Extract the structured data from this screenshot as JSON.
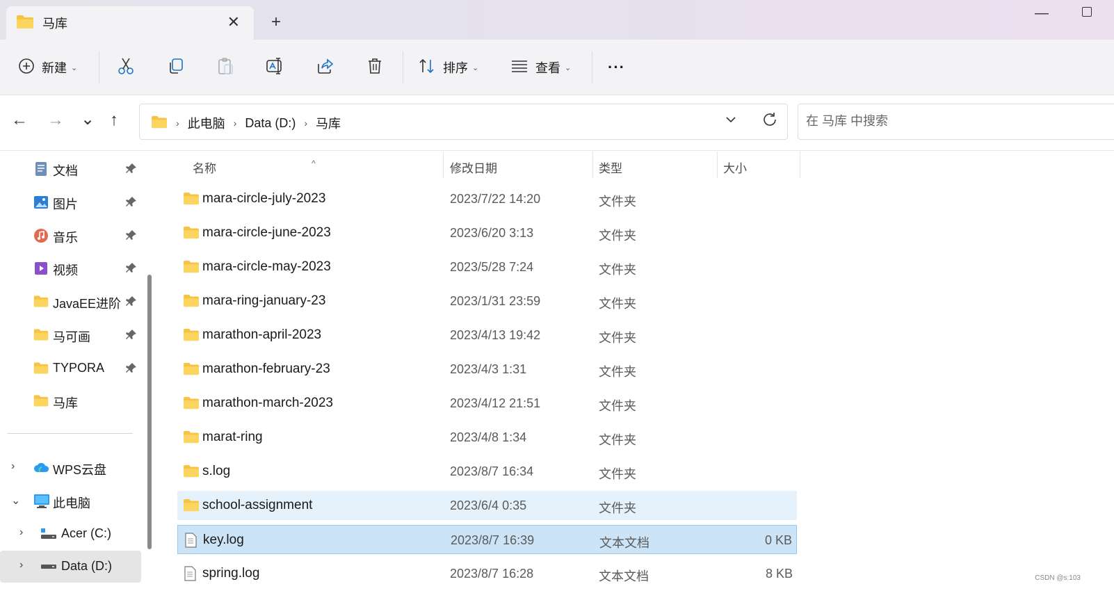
{
  "window": {
    "tab_title": "马库",
    "tab_close": "✕",
    "new_tab": "+",
    "minimize": "—"
  },
  "toolbar": {
    "new_label": "新建",
    "sort_label": "排序",
    "view_label": "查看",
    "more_label": "···"
  },
  "nav": {
    "back": "←",
    "forward": "→",
    "recent": "⌄",
    "up": "↑"
  },
  "address": {
    "crumbs": [
      "此电脑",
      "Data (D:)",
      "马库"
    ],
    "separator": "›"
  },
  "search": {
    "placeholder": "在 马库 中搜索"
  },
  "sidebar": {
    "quick_access": [
      {
        "label": "文档",
        "icon": "documents-icon",
        "pinned": true
      },
      {
        "label": "图片",
        "icon": "pictures-icon",
        "pinned": true
      },
      {
        "label": "音乐",
        "icon": "music-icon",
        "pinned": true
      },
      {
        "label": "视频",
        "icon": "videos-icon",
        "pinned": true
      },
      {
        "label": "JavaEE进阶",
        "icon": "folder-icon",
        "pinned": true
      },
      {
        "label": "马可画",
        "icon": "folder-icon",
        "pinned": true
      },
      {
        "label": "TYPORA",
        "icon": "folder-icon",
        "pinned": true
      },
      {
        "label": "马库",
        "icon": "folder-icon",
        "pinned": false
      }
    ],
    "tree": [
      {
        "label": "WPS云盘",
        "icon": "cloud-icon",
        "chevron": "›"
      },
      {
        "label": "此电脑",
        "icon": "pc-icon",
        "chevron": "⌄"
      },
      {
        "label": "Acer (C:)",
        "icon": "drive-c-icon",
        "chevron": "›"
      },
      {
        "label": "Data (D:)",
        "icon": "drive-icon",
        "chevron": "›"
      }
    ],
    "pin_glyph": "📌"
  },
  "columns": {
    "name": "名称",
    "date": "修改日期",
    "type": "类型",
    "size": "大小",
    "sort_arrow": "^"
  },
  "files": [
    {
      "name": "mara-circle-july-2023",
      "date": "2023/7/22 14:20",
      "type": "文件夹",
      "size": ""
    },
    {
      "name": "mara-circle-june-2023",
      "date": "2023/6/20 3:13",
      "type": "文件夹",
      "size": ""
    },
    {
      "name": "mara-circle-may-2023",
      "date": "2023/5/28 7:24",
      "type": "文件夹",
      "size": ""
    },
    {
      "name": "mara-ring-january-23",
      "date": "2023/1/31 23:59",
      "type": "文件夹",
      "size": ""
    },
    {
      "name": "marathon-april-2023",
      "date": "2023/4/13 19:42",
      "type": "文件夹",
      "size": ""
    },
    {
      "name": "marathon-february-23",
      "date": "2023/4/3 1:31",
      "type": "文件夹",
      "size": ""
    },
    {
      "name": "marathon-march-2023",
      "date": "2023/4/12 21:51",
      "type": "文件夹",
      "size": ""
    },
    {
      "name": "marat-ring",
      "date": "2023/4/8 1:34",
      "type": "文件夹",
      "size": ""
    },
    {
      "name": "s.log",
      "date": "2023/8/7 16:34",
      "type": "文件夹",
      "size": ""
    },
    {
      "name": "school-assignment",
      "date": "2023/6/4 0:35",
      "type": "文件夹",
      "size": ""
    },
    {
      "name": "key.log",
      "date": "2023/8/7 16:39",
      "type": "文本文档",
      "size": "0 KB"
    },
    {
      "name": "spring.log",
      "date": "2023/8/7 16:28",
      "type": "文本文档",
      "size": "8 KB"
    }
  ],
  "watermark": "CSDN @s:103",
  "colors": {
    "folder": "#f6c344",
    "selected_row": "#cce4f7",
    "hover_row": "#e5f1fb",
    "accent": "#1a73c8"
  }
}
